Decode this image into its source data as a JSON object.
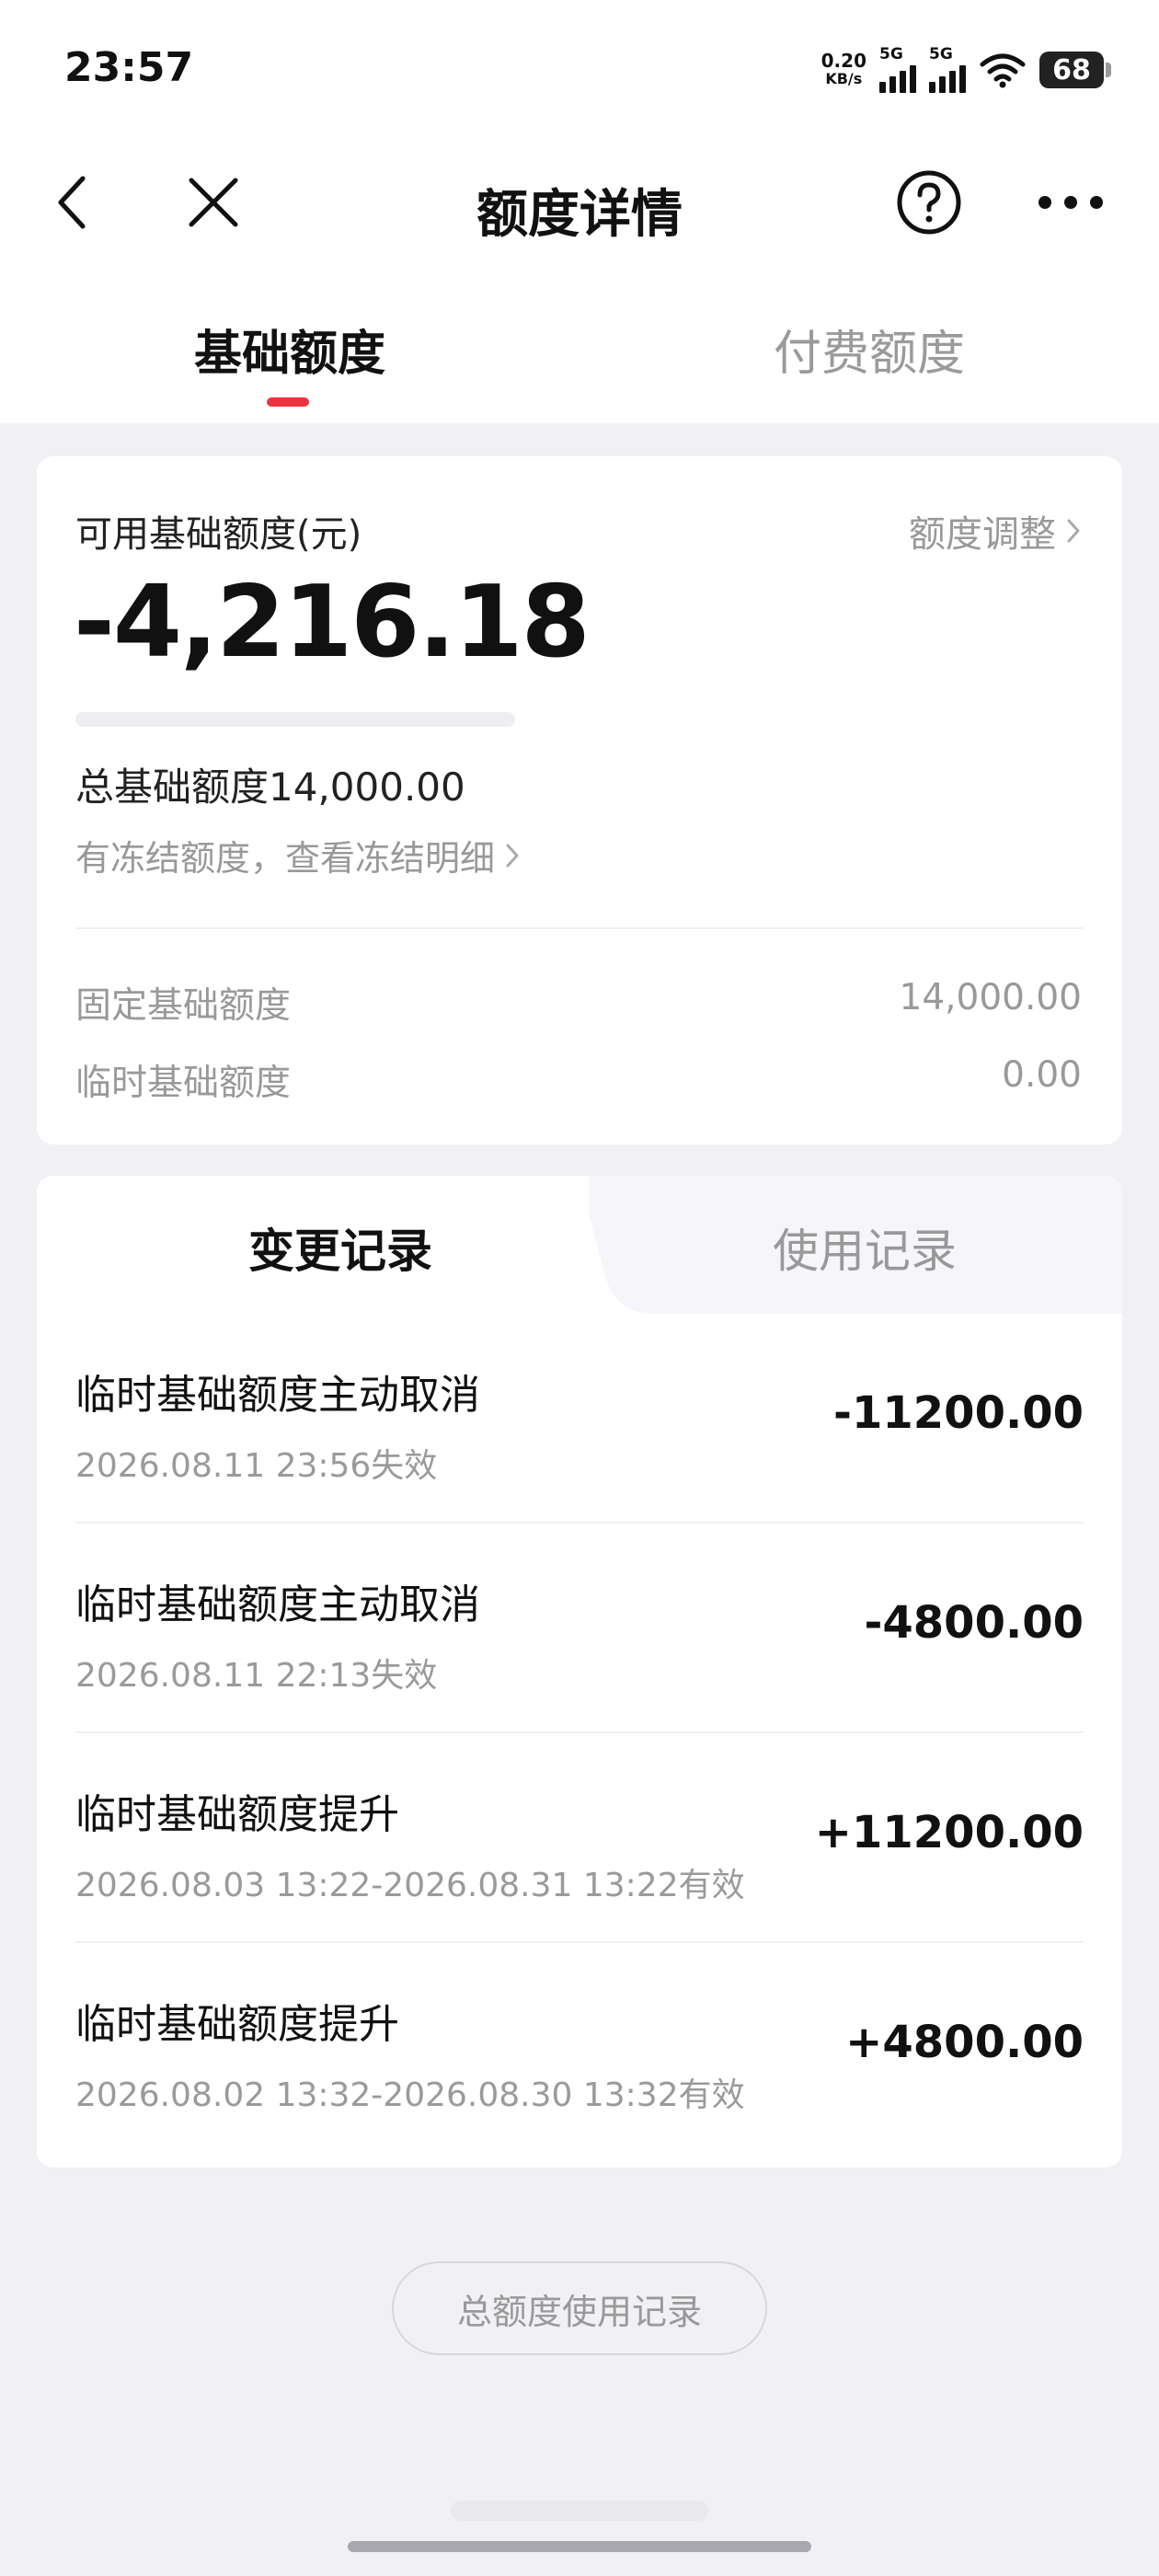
{
  "status_bar": {
    "time": "23:57",
    "net_speed": "0.20",
    "net_unit": "KB/s",
    "signal1_label": "5G",
    "signal2_label": "5G",
    "battery": "68"
  },
  "nav": {
    "title": "额度详情",
    "back_icon": "chevron-left-icon",
    "close_icon": "close-icon",
    "help_icon": "help-circle-icon",
    "more_icon": "more-dots-icon"
  },
  "top_tabs": [
    {
      "label": "基础额度",
      "active": true
    },
    {
      "label": "付费额度",
      "active": false
    }
  ],
  "summary": {
    "available_label": "可用基础额度(元)",
    "adjust_label": "额度调整",
    "available_amount": "-4,216.18",
    "progress_fraction": 0,
    "total_line": "总基础额度14,000.00",
    "frozen_link": "有冻结额度，查看冻结明细",
    "fixed_label": "固定基础额度",
    "fixed_value": "14,000.00",
    "temp_label": "临时基础额度",
    "temp_value": "0.00"
  },
  "records": {
    "tabs": [
      {
        "label": "变更记录",
        "active": true
      },
      {
        "label": "使用记录",
        "active": false
      }
    ],
    "items": [
      {
        "title": "临时基础额度主动取消",
        "date": "2026.08.11 23:56失效",
        "amount": "-11200.00"
      },
      {
        "title": "临时基础额度主动取消",
        "date": "2026.08.11 22:13失效",
        "amount": "-4800.00"
      },
      {
        "title": "临时基础额度提升",
        "date": "2026.08.03 13:22-2026.08.31 13:22有效",
        "amount": "+11200.00"
      },
      {
        "title": "临时基础额度提升",
        "date": "2026.08.02 13:32-2026.08.30 13:32有效",
        "amount": "+4800.00"
      }
    ]
  },
  "footer": {
    "total_usage_button": "总额度使用记录"
  },
  "colors": {
    "accent": "#ee3340",
    "background": "#f1f1f5",
    "muted_text": "#999999"
  }
}
